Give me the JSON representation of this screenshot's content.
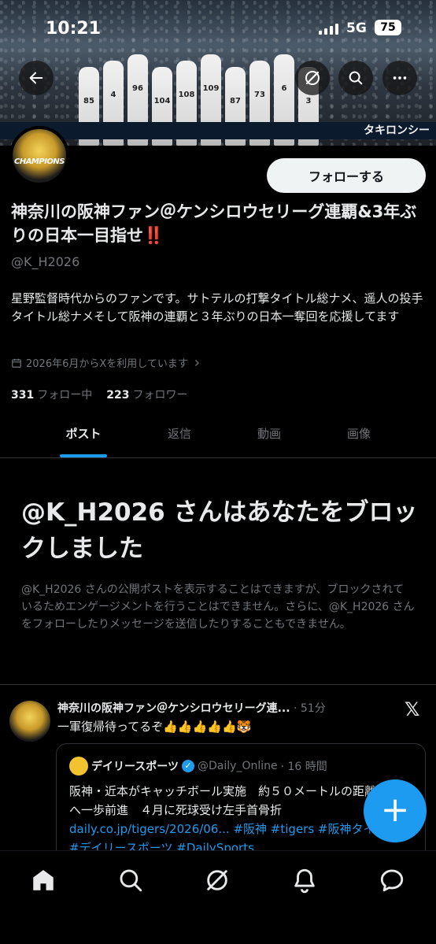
{
  "status_bar": {
    "time": "10:21",
    "network": "5G",
    "battery": "75"
  },
  "banner": {
    "ad_text": "タキロンシー",
    "numbers": [
      "85",
      "4",
      "96",
      "104",
      "108",
      "109",
      "87",
      "73",
      "6",
      "3"
    ]
  },
  "profile": {
    "follow_label": "フォローする",
    "display_name": "神奈川の阪神ファン＠ケンシロウセリーグ連覇&3年ぶりの日本一目指せ",
    "name_emoji": "‼️",
    "handle": "@K_H2026",
    "bio": "星野監督時代からのファンです。サトテルの打撃タイトル総ナメ、遥人の投手タイトル総ナメそして阪神の連覇と３年ぶりの日本一奪回を応援してます",
    "joined": "2026年6月からXを利用しています",
    "following_count": "331",
    "following_label": "フォロー中",
    "followers_count": "223",
    "followers_label": "フォロワー",
    "avatar_text": "CHAMPIONS"
  },
  "tabs": [
    "ポスト",
    "返信",
    "動画",
    "画像"
  ],
  "blocked": {
    "title": "@K_H2026 さんはあなたをブロックしました",
    "description": "@K_H2026 さんの公開ポストを表示することはできますが、ブロックされているためエンゲージメントを行うことはできません。さらに、@K_H2026 さんをフォローしたりメッセージを送信したりすることもできません。"
  },
  "tweet": {
    "author": "神奈川の阪神ファン＠ケンシロウセリーグ連...",
    "time": "· 51分",
    "text": "一軍復帰待ってるぞ👍👍👍👍👍🐯",
    "quote": {
      "author": "デイリースポーツ",
      "handle": "@Daily_Online",
      "time": "· 16 時間",
      "body": "阪神・近本がキャッチボール実施　約５０メートルの距離　復活へ一歩前進　４月に死球受け左手首骨折",
      "link": "daily.co.jp/tigers/2026/06...",
      "hashtags": "#阪神 #tigers #阪神タイガース #デイリースポーツ #DailySports"
    }
  },
  "fab_label": "+"
}
